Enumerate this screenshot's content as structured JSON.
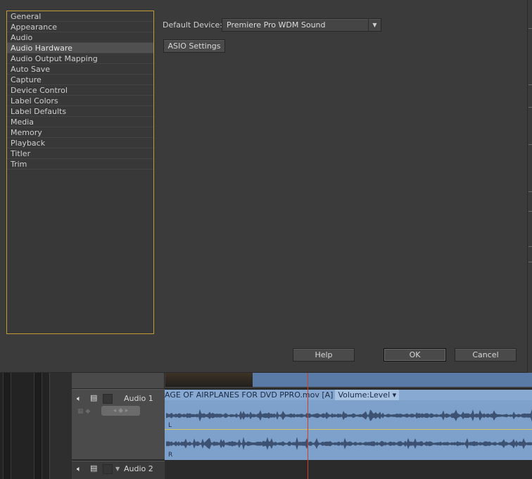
{
  "dialog": {
    "categories": [
      "General",
      "Appearance",
      "Audio",
      "Audio Hardware",
      "Audio Output Mapping",
      "Auto Save",
      "Capture",
      "Device Control",
      "Label Colors",
      "Label Defaults",
      "Media",
      "Memory",
      "Playback",
      "Titler",
      "Trim"
    ],
    "selected_index": 3,
    "default_device_label": "Default Device:",
    "default_device_value": "Premiere Pro WDM Sound",
    "asio_button": "ASIO Settings",
    "help_button": "Help",
    "ok_button": "OK",
    "cancel_button": "Cancel",
    "accent_color": "#c29b34"
  },
  "timeline": {
    "audio1_label": "Audio 1",
    "audio2_label": "Audio 2",
    "clip_title": "AGE OF AIRPLANES FOR DVD PPRO.mov [A]",
    "volume_label": "Volume:Level",
    "channel_left": "L",
    "channel_right": "R",
    "clip_color": "#7ea1cb",
    "playhead_color": "#d23b2a"
  }
}
